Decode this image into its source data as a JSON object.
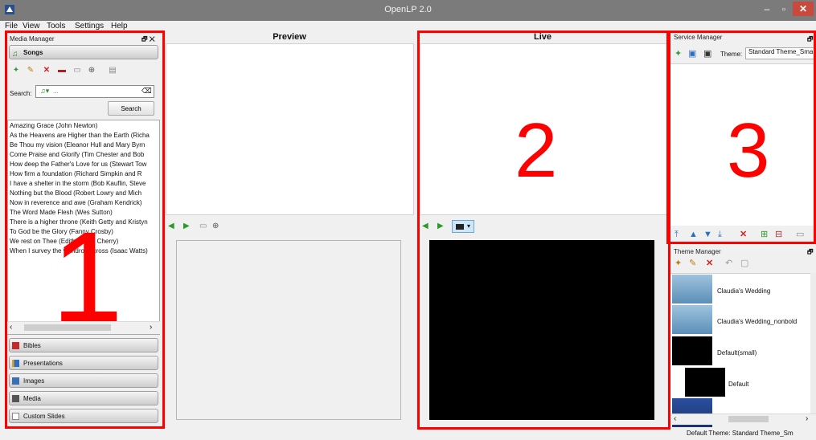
{
  "window": {
    "title": "OpenLP 2.0",
    "minimize_glyph": "–",
    "maximize_glyph": "▫",
    "close_glyph": "✕"
  },
  "menu": [
    "File",
    "View",
    "Tools",
    "Settings",
    "Help"
  ],
  "media_manager": {
    "title": "Media Manager",
    "dock_controls": "🗗 ✕",
    "active_tab": "Songs",
    "search_label": "Search:",
    "search_value": "",
    "search_placeholder": "...",
    "search_button": "Search",
    "songs": [
      "Amazing Grace (John Newton)",
      "As the Heavens are Higher than the Earth (Richa",
      "Be Thou my vision (Eleanor Hull and Mary Byrn",
      "Come Praise and Glorify (Tim Chester and Bob",
      "How deep the Father's Love for us (Stewart Tow",
      "How firm a foundation (Richard Simpkin and R",
      "I have a shelter in the storm (Bob Kauflin, Steve",
      "Nothing but the Blood (Robert Lowry and Mich",
      "Now in reverence and awe (Graham Kendrick)",
      "The Word Made Flesh (Wes Sutton)",
      "There is a higher throne (Keith Getty and Kristyn",
      "To God be the Glory (Fanny Crosby)",
      "We rest on Thee (Edith Gilling Cherry)",
      "When I survey the wondrous cross (Isaac Watts)"
    ],
    "other_tabs": [
      "Bibles",
      "Presentations",
      "Images",
      "Media",
      "Custom Slides"
    ]
  },
  "preview": {
    "title": "Preview"
  },
  "live": {
    "title": "Live"
  },
  "service_manager": {
    "title": "Service Manager",
    "dock_controls": "🗗",
    "theme_label": "Theme:",
    "theme_value": "Standard Theme_Sma"
  },
  "theme_manager": {
    "title": "Theme Manager",
    "dock_controls": "🗗",
    "themes": [
      "Claudia's Wedding",
      "Claudia's Wedding_nonbold",
      "Default(small)",
      "Default"
    ]
  },
  "status_bar": {
    "text": "Default Theme: Standard Theme_Sm"
  },
  "annotations": [
    "1",
    "2",
    "3"
  ],
  "colors": {
    "annotation_red": "#ff0000",
    "titlebar": "#7b7b7b",
    "close_button": "#c74a3c"
  }
}
